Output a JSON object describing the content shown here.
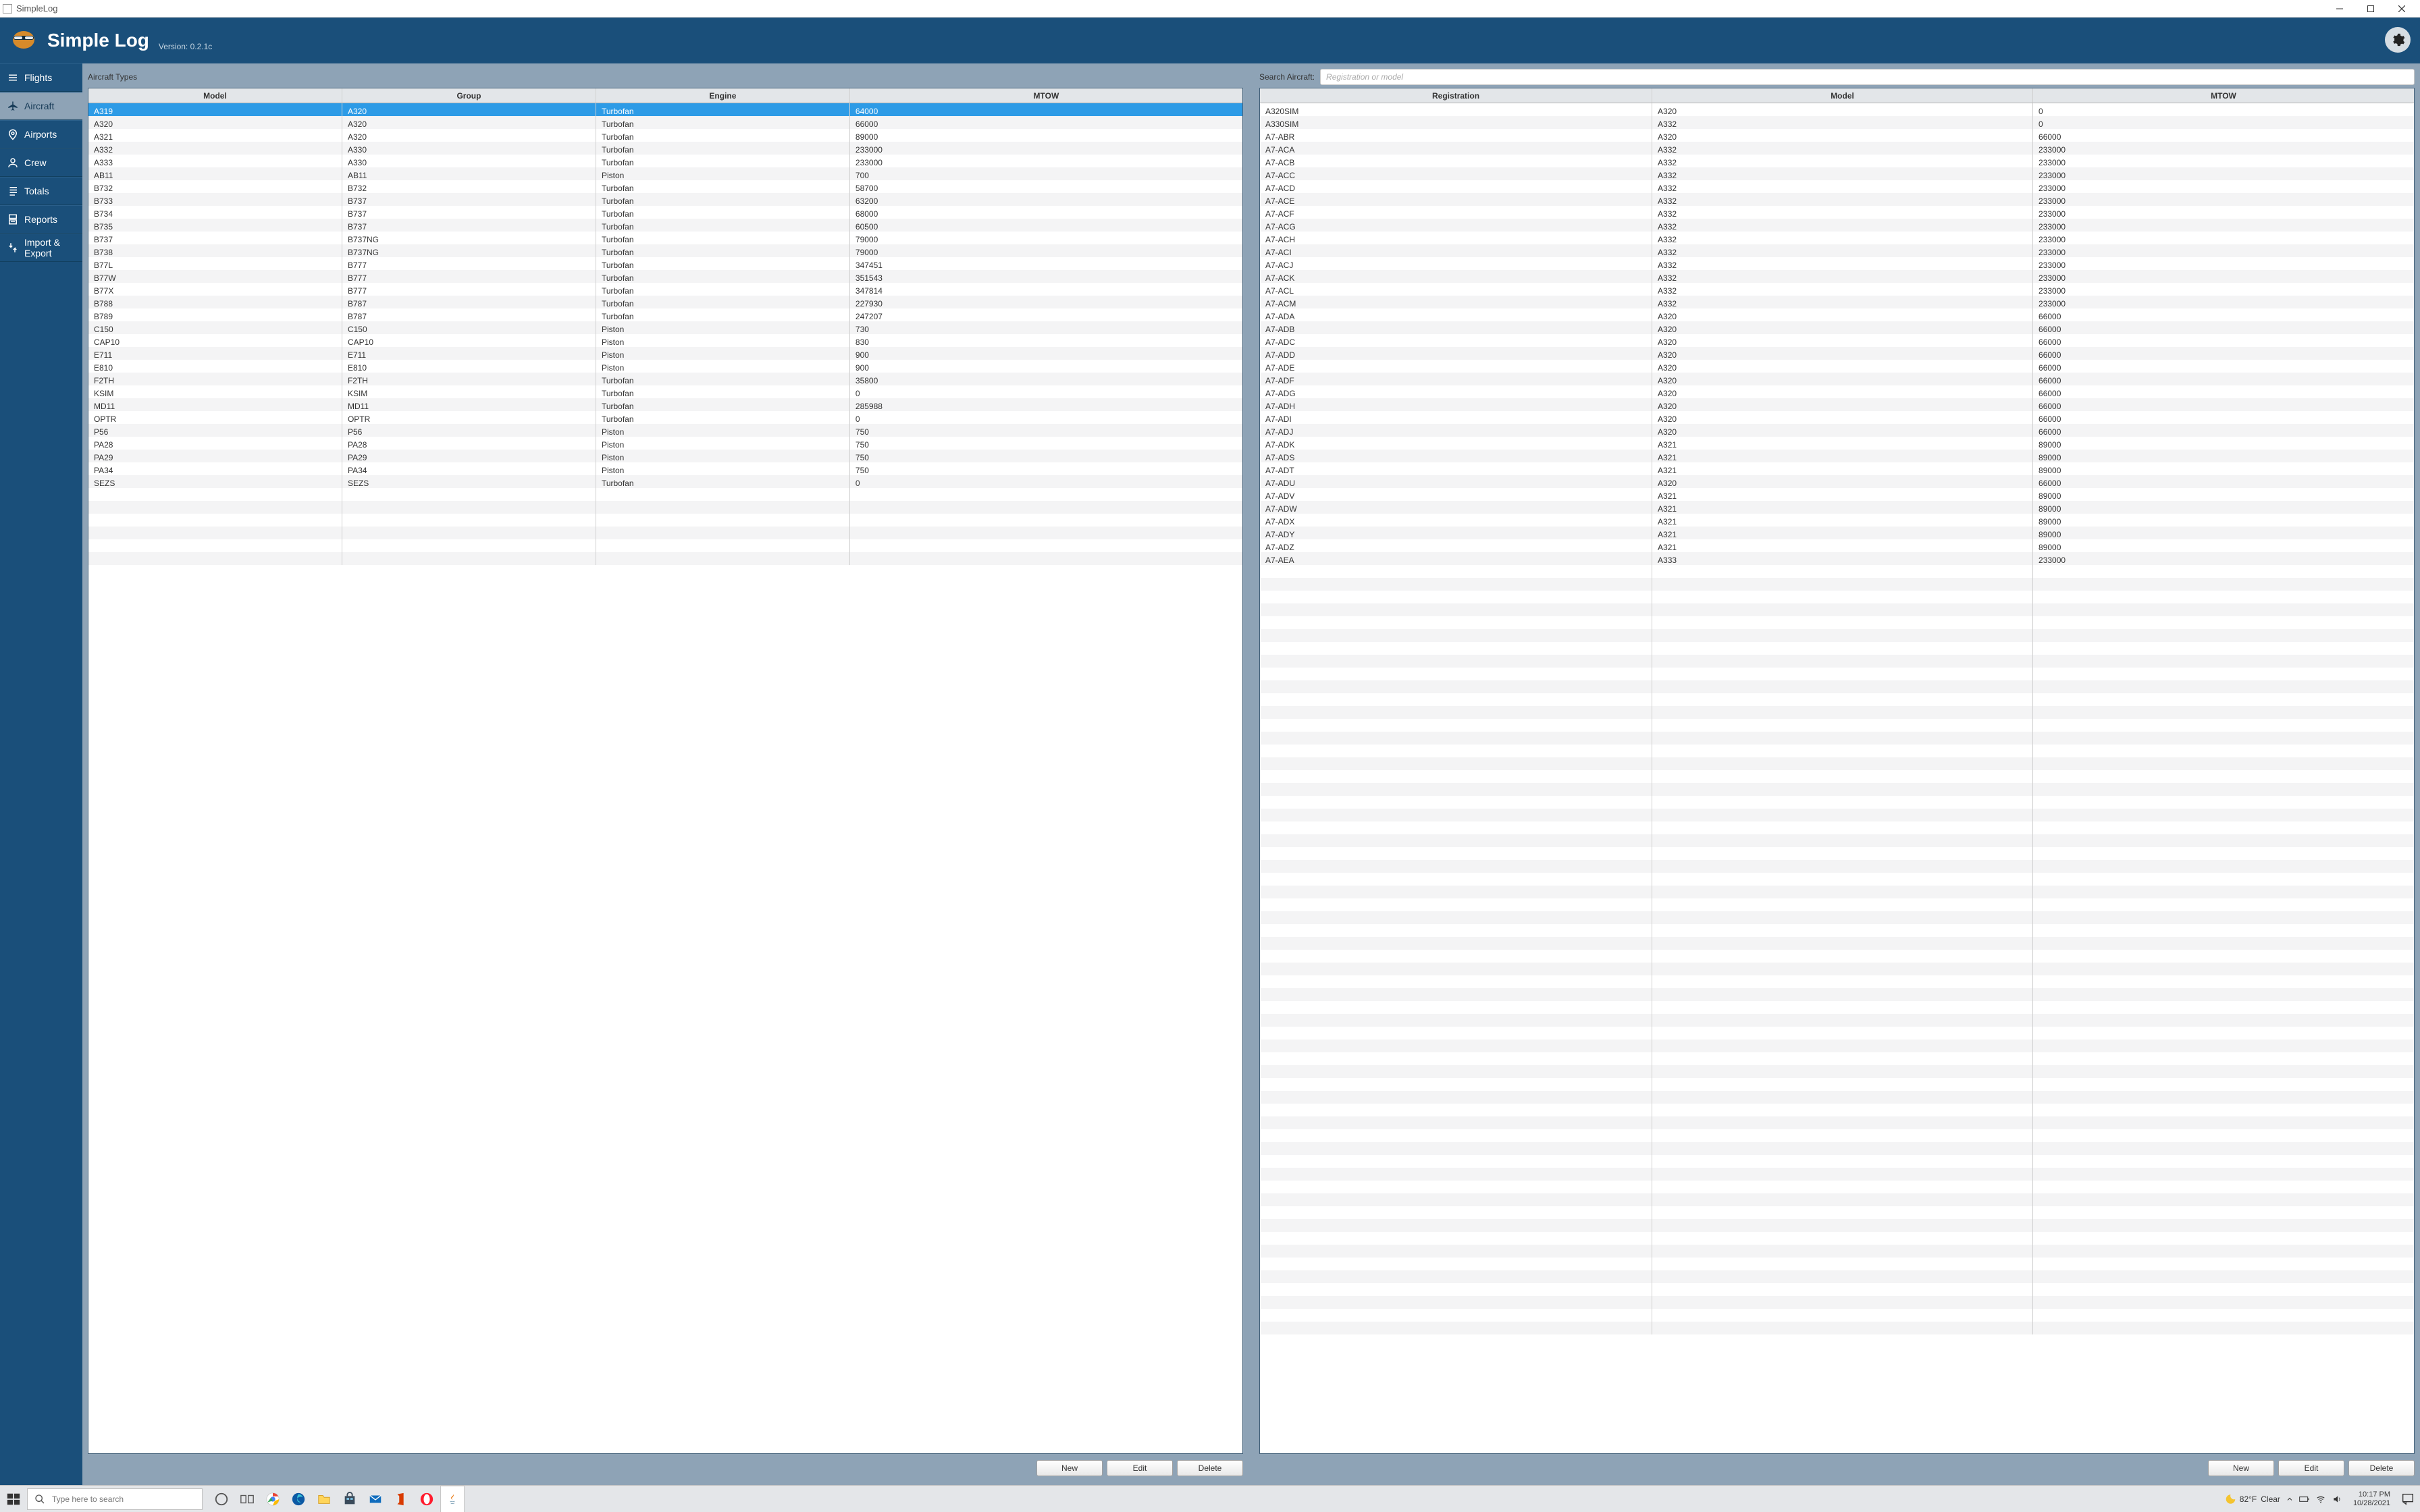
{
  "window": {
    "title": "SimpleLog"
  },
  "header": {
    "title": "Simple Log",
    "version": "Version: 0.2.1c"
  },
  "sidebar": {
    "items": [
      {
        "label": "Flights"
      },
      {
        "label": "Aircraft"
      },
      {
        "label": "Airports"
      },
      {
        "label": "Crew"
      },
      {
        "label": "Totals"
      },
      {
        "label": "Reports"
      },
      {
        "label": "Import & Export"
      }
    ],
    "active_index": 1
  },
  "left_pane": {
    "title": "Aircraft Types",
    "columns": [
      "Model",
      "Group",
      "Engine",
      "MTOW"
    ],
    "selected_index": 0,
    "rows": [
      [
        "A319",
        "A320",
        "Turbofan",
        "64000"
      ],
      [
        "A320",
        "A320",
        "Turbofan",
        "66000"
      ],
      [
        "A321",
        "A320",
        "Turbofan",
        "89000"
      ],
      [
        "A332",
        "A330",
        "Turbofan",
        "233000"
      ],
      [
        "A333",
        "A330",
        "Turbofan",
        "233000"
      ],
      [
        "AB11",
        "AB11",
        "Piston",
        "700"
      ],
      [
        "B732",
        "B732",
        "Turbofan",
        "58700"
      ],
      [
        "B733",
        "B737",
        "Turbofan",
        "63200"
      ],
      [
        "B734",
        "B737",
        "Turbofan",
        "68000"
      ],
      [
        "B735",
        "B737",
        "Turbofan",
        "60500"
      ],
      [
        "B737",
        "B737NG",
        "Turbofan",
        "79000"
      ],
      [
        "B738",
        "B737NG",
        "Turbofan",
        "79000"
      ],
      [
        "B77L",
        "B777",
        "Turbofan",
        "347451"
      ],
      [
        "B77W",
        "B777",
        "Turbofan",
        "351543"
      ],
      [
        "B77X",
        "B777",
        "Turbofan",
        "347814"
      ],
      [
        "B788",
        "B787",
        "Turbofan",
        "227930"
      ],
      [
        "B789",
        "B787",
        "Turbofan",
        "247207"
      ],
      [
        "C150",
        "C150",
        "Piston",
        "730"
      ],
      [
        "CAP10",
        "CAP10",
        "Piston",
        "830"
      ],
      [
        "E711",
        "E711",
        "Piston",
        "900"
      ],
      [
        "E810",
        "E810",
        "Piston",
        "900"
      ],
      [
        "F2TH",
        "F2TH",
        "Turbofan",
        "35800"
      ],
      [
        "KSIM",
        "KSIM",
        "Turbofan",
        "0"
      ],
      [
        "MD11",
        "MD11",
        "Turbofan",
        "285988"
      ],
      [
        "OPTR",
        "OPTR",
        "Turbofan",
        "0"
      ],
      [
        "P56",
        "P56",
        "Piston",
        "750"
      ],
      [
        "PA28",
        "PA28",
        "Piston",
        "750"
      ],
      [
        "PA29",
        "PA29",
        "Piston",
        "750"
      ],
      [
        "PA34",
        "PA34",
        "Piston",
        "750"
      ],
      [
        "SEZS",
        "SEZS",
        "Turbofan",
        "0"
      ]
    ],
    "actions": {
      "new": "New",
      "edit": "Edit",
      "delete": "Delete"
    }
  },
  "right_pane": {
    "search_label": "Search Aircraft:",
    "search_placeholder": "Registration or model",
    "columns": [
      "Registration",
      "Model",
      "MTOW"
    ],
    "rows": [
      [
        "A320SIM",
        "A320",
        "0"
      ],
      [
        "A330SIM",
        "A332",
        "0"
      ],
      [
        "A7-ABR",
        "A320",
        "66000"
      ],
      [
        "A7-ACA",
        "A332",
        "233000"
      ],
      [
        "A7-ACB",
        "A332",
        "233000"
      ],
      [
        "A7-ACC",
        "A332",
        "233000"
      ],
      [
        "A7-ACD",
        "A332",
        "233000"
      ],
      [
        "A7-ACE",
        "A332",
        "233000"
      ],
      [
        "A7-ACF",
        "A332",
        "233000"
      ],
      [
        "A7-ACG",
        "A332",
        "233000"
      ],
      [
        "A7-ACH",
        "A332",
        "233000"
      ],
      [
        "A7-ACI",
        "A332",
        "233000"
      ],
      [
        "A7-ACJ",
        "A332",
        "233000"
      ],
      [
        "A7-ACK",
        "A332",
        "233000"
      ],
      [
        "A7-ACL",
        "A332",
        "233000"
      ],
      [
        "A7-ACM",
        "A332",
        "233000"
      ],
      [
        "A7-ADA",
        "A320",
        "66000"
      ],
      [
        "A7-ADB",
        "A320",
        "66000"
      ],
      [
        "A7-ADC",
        "A320",
        "66000"
      ],
      [
        "A7-ADD",
        "A320",
        "66000"
      ],
      [
        "A7-ADE",
        "A320",
        "66000"
      ],
      [
        "A7-ADF",
        "A320",
        "66000"
      ],
      [
        "A7-ADG",
        "A320",
        "66000"
      ],
      [
        "A7-ADH",
        "A320",
        "66000"
      ],
      [
        "A7-ADI",
        "A320",
        "66000"
      ],
      [
        "A7-ADJ",
        "A320",
        "66000"
      ],
      [
        "A7-ADK",
        "A321",
        "89000"
      ],
      [
        "A7-ADS",
        "A321",
        "89000"
      ],
      [
        "A7-ADT",
        "A321",
        "89000"
      ],
      [
        "A7-ADU",
        "A320",
        "66000"
      ],
      [
        "A7-ADV",
        "A321",
        "89000"
      ],
      [
        "A7-ADW",
        "A321",
        "89000"
      ],
      [
        "A7-ADX",
        "A321",
        "89000"
      ],
      [
        "A7-ADY",
        "A321",
        "89000"
      ],
      [
        "A7-ADZ",
        "A321",
        "89000"
      ],
      [
        "A7-AEA",
        "A333",
        "233000"
      ]
    ],
    "actions": {
      "new": "New",
      "edit": "Edit",
      "delete": "Delete"
    }
  },
  "taskbar": {
    "search_placeholder": "Type here to search",
    "weather": {
      "temp": "82°F",
      "cond": "Clear"
    },
    "time": "10:17 PM",
    "date": "10/28/2021"
  }
}
